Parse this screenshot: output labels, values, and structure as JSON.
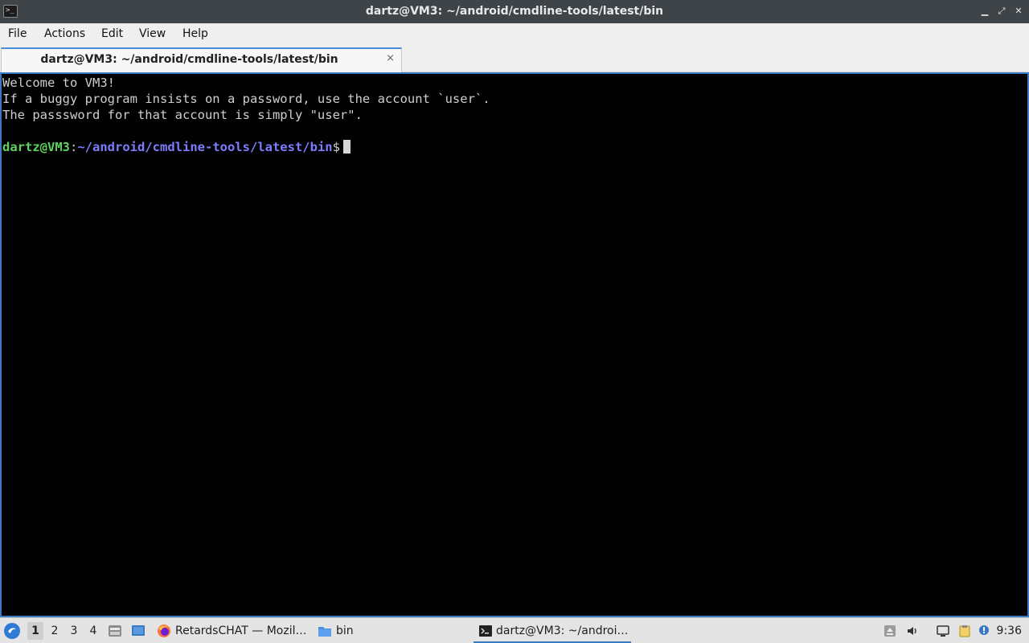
{
  "window": {
    "title": "dartz@VM3: ~/android/cmdline-tools/latest/bin",
    "icon": "terminal-icon",
    "controls": [
      "minimize-icon",
      "restore-icon",
      "close-icon"
    ]
  },
  "menubar": {
    "items": [
      "File",
      "Actions",
      "Edit",
      "View",
      "Help"
    ]
  },
  "tabs": [
    {
      "label": "dartz@VM3: ~/android/cmdline-tools/latest/bin",
      "close_glyph": "×"
    }
  ],
  "terminal": {
    "lines": [
      "Welcome to VM3!",
      "If a buggy program insists on a password, use the account `user`.",
      "The passsword for that account is simply \"user\".",
      ""
    ],
    "prompt": {
      "user_host": "dartz@VM3",
      "separator": ":",
      "path": "~/android/cmdline-tools/latest/bin",
      "symbol": "$"
    }
  },
  "taskbar": {
    "start_icon": "start-menu-icon",
    "workspaces": [
      "1",
      "2",
      "3",
      "4"
    ],
    "active_workspace": "1",
    "quick_launch": [
      "file-manager-icon",
      "desktop-icon"
    ],
    "tasks": [
      {
        "icon": "firefox-icon",
        "label": "RetardsCHAT — Mozil…"
      },
      {
        "icon": "folder-icon",
        "label": "bin"
      },
      {
        "icon": "terminal-icon",
        "label": "dartz@VM3: ~/androi…"
      }
    ],
    "tray": [
      "eject-icon",
      "volume-icon",
      "network-icon",
      "clipboard-icon",
      "update-notifier-icon"
    ],
    "clock": "9:36"
  },
  "colors": {
    "terminal_bg": "#000000",
    "terminal_fg": "#cfcfcf",
    "prompt_user": "#5fd35f",
    "prompt_path": "#7d7dff",
    "accent": "#3b78c4"
  }
}
